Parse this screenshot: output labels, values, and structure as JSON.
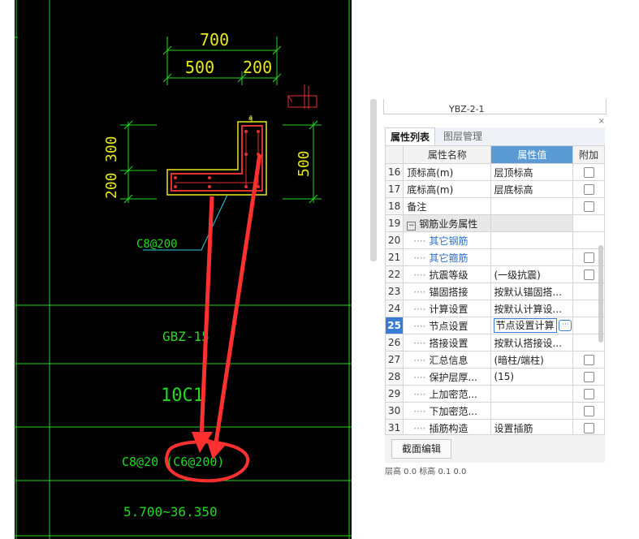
{
  "cad": {
    "dims": {
      "total": "700",
      "left": "500",
      "right": "200",
      "v_upper": "300",
      "v_lower": "200",
      "v_right": "500"
    },
    "rebar_label": "C8@200",
    "member_name": "GBZ-15",
    "main_rebar": "10C1",
    "stirrup_spec": "C8@20 (C6@200)",
    "elevation_range": "5.700~36.350",
    "colors": {
      "line": "#22d822",
      "dim": "#e8e820",
      "section": "#e03030",
      "annot_red": "#ff3030",
      "leader": "#2ad0e0"
    }
  },
  "panel": {
    "top_label": "YBZ-2-1",
    "close_glyph": "×",
    "tabs": [
      {
        "label": "属性列表",
        "active": true
      },
      {
        "label": "图层管理",
        "active": false
      }
    ],
    "columns": {
      "name": "属性名称",
      "value": "属性值",
      "extra": "附加"
    },
    "rows": [
      {
        "num": "16",
        "name": "顶标高(m)",
        "value": "层顶标高",
        "check": true
      },
      {
        "num": "17",
        "name": "底标高(m)",
        "value": "层底标高",
        "check": true
      },
      {
        "num": "18",
        "name": "备注",
        "value": "",
        "check": true
      },
      {
        "num": "19",
        "name": "钢筋业务属性",
        "value": "",
        "check": false,
        "group": true,
        "collapse": "−"
      },
      {
        "num": "20",
        "name": "其它钢筋",
        "value": "",
        "check": false,
        "child": true,
        "blue": true
      },
      {
        "num": "21",
        "name": "其它箍筋",
        "value": "",
        "check": true,
        "child": true,
        "blue": true
      },
      {
        "num": "22",
        "name": "抗震等级",
        "value": "(一级抗震)",
        "check": true,
        "child": true
      },
      {
        "num": "23",
        "name": "锚固搭接",
        "value": "按默认锚固搭...",
        "check": false,
        "child": true
      },
      {
        "num": "24",
        "name": "计算设置",
        "value": "按默认计算设...",
        "check": false,
        "child": true
      },
      {
        "num": "25",
        "name": "节点设置",
        "value": "节点设置计算",
        "check": false,
        "child": true,
        "current": true,
        "editing": true
      },
      {
        "num": "26",
        "name": "搭接设置",
        "value": "按默认搭接设...",
        "check": false,
        "child": true
      },
      {
        "num": "27",
        "name": "汇总信息",
        "value": "(暗柱/端柱)",
        "check": true,
        "child": true
      },
      {
        "num": "28",
        "name": "保护层厚...",
        "value": "(15)",
        "check": true,
        "child": true
      },
      {
        "num": "29",
        "name": "上加密范...",
        "value": "",
        "check": true,
        "child": true
      },
      {
        "num": "30",
        "name": "下加密范...",
        "value": "",
        "check": true,
        "child": true
      },
      {
        "num": "31",
        "name": "插筋构造",
        "value": "设置插筋",
        "check": true,
        "child": true
      }
    ],
    "bottom_button": "截面编辑",
    "footer": "层高 0.0 标高 0.1 0.0",
    "ellipsis": "···"
  }
}
